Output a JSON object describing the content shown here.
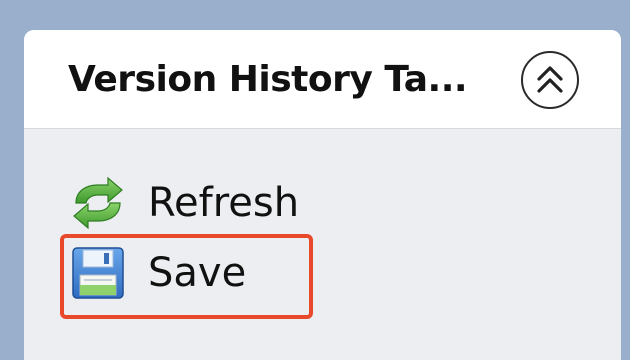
{
  "panel": {
    "title": "Version History Ta...",
    "collapse_icon": "double-chevron-up-icon"
  },
  "actions": [
    {
      "label": "Refresh",
      "icon": "refresh-icon"
    },
    {
      "label": "Save",
      "icon": "floppy-disk-icon"
    }
  ],
  "colors": {
    "background": "#9aafcb",
    "panel_body": "#eceef2",
    "header": "#ffffff",
    "highlight": "#e8492b",
    "refresh_green": "#4caf3f",
    "floppy_blue": "#3f7fd0"
  }
}
